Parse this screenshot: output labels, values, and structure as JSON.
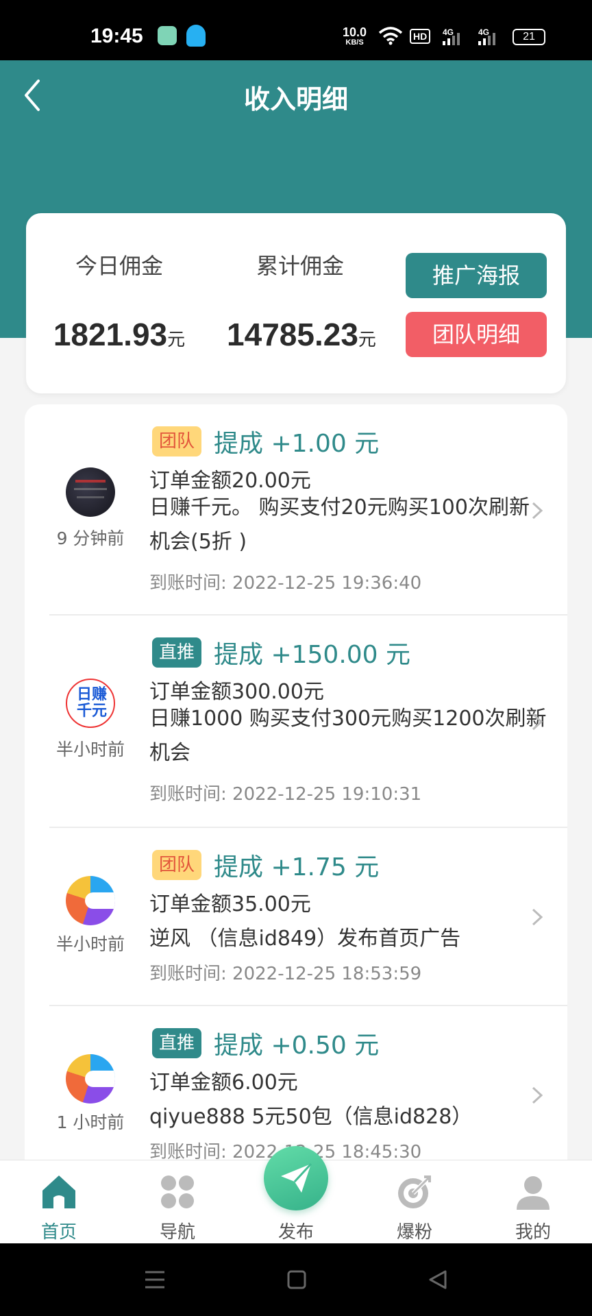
{
  "status_bar": {
    "time": "19:45",
    "net_speed_value": "10.0",
    "net_speed_unit": "KB/S",
    "hd": "HD",
    "signal_1": "4G",
    "signal_2": "4G",
    "battery": "21"
  },
  "header": {
    "title": "收入明细"
  },
  "summary": {
    "today_label": "今日佣金",
    "today_value": "1821.93",
    "total_label": "累计佣金",
    "total_value": "14785.23",
    "unit": "元",
    "poster_button": "推广海报",
    "team_button": "团队明细"
  },
  "records": [
    {
      "tag": "团队",
      "tag_type": "team",
      "commission": "提成 +1.00 元",
      "when": "9 分钟前",
      "order_amount": "订单金额20.00元",
      "description": "日赚千元。 购买支付20元购买100次刷新机会(5折 )",
      "arrival": "到账时间: 2022-12-25 19:36:40",
      "avatar_icon": "dark-photo-avatar"
    },
    {
      "tag": "直推",
      "tag_type": "direct",
      "commission": "提成 +150.00 元",
      "when": "半小时前",
      "order_amount": "订单金额300.00元",
      "description": "日赚1000 购买支付300元购买1200次刷新机会",
      "arrival": "到账时间: 2022-12-25 19:10:31",
      "avatar_icon": "ri-zhuan-qian-yuan-avatar"
    },
    {
      "tag": "团队",
      "tag_type": "team",
      "commission": "提成 +1.75 元",
      "when": "半小时前",
      "order_amount": "订单金额35.00元",
      "description": "逆风 （信息id849）发布首页广告",
      "arrival": "到账时间: 2022-12-25 18:53:59",
      "avatar_icon": "colorful-c-logo-avatar"
    },
    {
      "tag": "直推",
      "tag_type": "direct",
      "commission": "提成 +0.50 元",
      "when": "1 小时前",
      "order_amount": "订单金额6.00元",
      "description": "qiyue888 5元50包（信息id828）",
      "arrival": "到账时间: 2022-12-25 18:45:30",
      "avatar_icon": "colorful-c-logo-avatar"
    }
  ],
  "bottom_nav": {
    "home": "首页",
    "navigate": "导航",
    "publish": "发布",
    "boost": "爆粉",
    "mine": "我的"
  },
  "colors": {
    "primary": "#2f8a8a",
    "danger": "#f25e66",
    "tag_team_bg": "#ffd77a",
    "tag_team_text": "#e2563b"
  }
}
